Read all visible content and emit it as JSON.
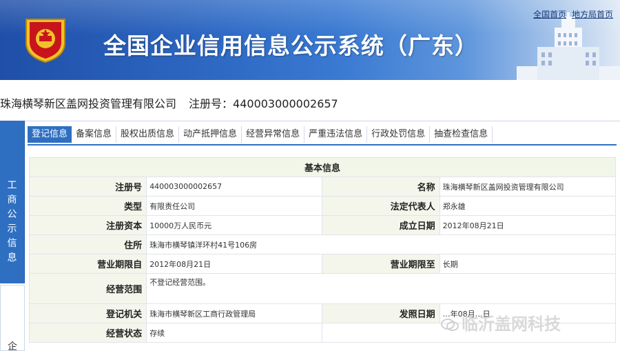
{
  "header": {
    "title": "全国企业信用信息公示系统（广东）",
    "links": [
      "全国首页",
      "地方局首页"
    ]
  },
  "company": {
    "name": "珠海横琴新区盖网投资管理有限公司",
    "reg_label": "注册号：",
    "reg_value": "440003000002657"
  },
  "side_tabs": {
    "primary": "工商公示信息",
    "secondary": "企"
  },
  "tabs": [
    {
      "label": "登记信息",
      "active": true
    },
    {
      "label": "备案信息",
      "active": false
    },
    {
      "label": "股权出质信息",
      "active": false
    },
    {
      "label": "动产抵押信息",
      "active": false
    },
    {
      "label": "经营异常信息",
      "active": false
    },
    {
      "label": "严重违法信息",
      "active": false
    },
    {
      "label": "行政处罚信息",
      "active": false
    },
    {
      "label": "抽查检查信息",
      "active": false
    }
  ],
  "basic_info": {
    "title": "基本信息",
    "rows": [
      {
        "l1": "注册号",
        "v1": "440003000002657",
        "l2": "名称",
        "v2": "珠海横琴新区盖网投资管理有限公司"
      },
      {
        "l1": "类型",
        "v1": "有限责任公司",
        "l2": "法定代表人",
        "v2": "郑永雄"
      },
      {
        "l1": "注册资本",
        "v1": "10000万人民币元",
        "l2": "成立日期",
        "v2": "2012年08月21日"
      },
      {
        "l1": "住所",
        "v1": "珠海市横琴镇洋环村41号106房"
      },
      {
        "l1": "营业期限自",
        "v1": "2012年08月21日",
        "l2": "营业期限至",
        "v2": "长期"
      },
      {
        "l1": "经营范围",
        "v1": "不登记经营范围。"
      },
      {
        "l1": "登记机关",
        "v1": "珠海市横琴新区工商行政管理局",
        "l2": "发照日期",
        "v2": "…年08月…日"
      },
      {
        "l1": "经营状态",
        "v1": "存续"
      }
    ]
  },
  "watermark": "临沂盖网科技",
  "colors": {
    "banner": "#2e69c4",
    "accent": "#2e6fc2",
    "label_bg": "#f4f6ec"
  }
}
